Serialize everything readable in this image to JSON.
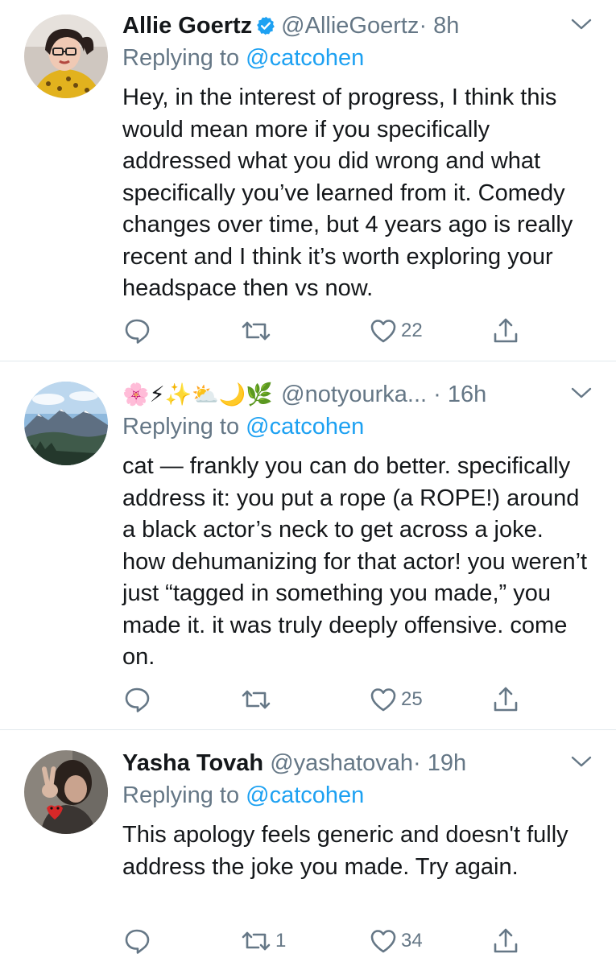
{
  "tweets": [
    {
      "name": "Allie Goertz",
      "verified": true,
      "handle": "@AllieGoertz",
      "time": "· 8h",
      "replying_prefix": "Replying to",
      "replying_to": "@catcohen",
      "text": "Hey, in the interest of progress, I think this would mean more if you specifically addressed what you did wrong and what specifically you’ve learned from it. Comedy changes over time, but 4 years ago is really recent and I think it’s worth exploring your headspace then vs now.",
      "actions": {
        "reply_count": "",
        "retweet_count": "",
        "like_count": "22",
        "share_count": ""
      }
    },
    {
      "name_emoji": "🌸⚡✨⛅🌙🌿",
      "handle": "@notyourka...",
      "time": "· 16h",
      "replying_prefix": "Replying to",
      "replying_to": "@catcohen",
      "text": "cat — frankly you can do better. specifically address it: you put a rope (a ROPE!) around a black actor’s neck to get across a joke. how dehumanizing for that actor! you weren’t just “tagged in something you made,” you made it. it was truly deeply offensive. come on.",
      "actions": {
        "reply_count": "",
        "retweet_count": "",
        "like_count": "25",
        "share_count": ""
      }
    },
    {
      "name": "Yasha Tovah",
      "handle": "@yashatovah",
      "time": "· 19h",
      "replying_prefix": "Replying to",
      "replying_to": "@catcohen",
      "text": "This apology feels generic and doesn't fully address the joke you made. Try again.",
      "actions": {
        "reply_count": "",
        "retweet_count": "1",
        "like_count": "34",
        "share_count": ""
      }
    }
  ],
  "colors": {
    "text": "#14171a",
    "secondary": "#657786",
    "link": "#1da1f2",
    "divider": "#e1e8ed",
    "verified": "#1da1f2"
  },
  "icons": {
    "reply": "reply-icon",
    "retweet": "retweet-icon",
    "like": "heart-icon",
    "share": "share-icon",
    "more": "chevron-down-icon",
    "verified": "verified-badge-icon"
  }
}
